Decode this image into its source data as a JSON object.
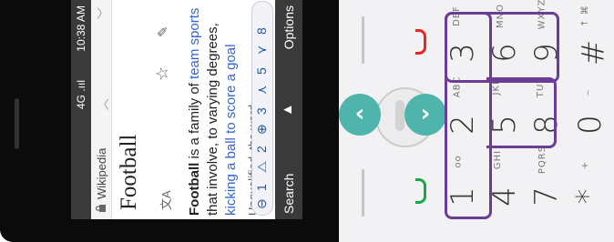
{
  "status": {
    "network": "4G .ııl",
    "battery_time": "10:38 AM"
  },
  "site": {
    "name": "Wikipedia"
  },
  "page": {
    "title": "Football"
  },
  "article": {
    "bold_word": "Football",
    "text1": " is a family of ",
    "link1": "team sports",
    "text2": " that involve, to varying degrees, ",
    "link2": "kicking a ball to score a goal",
    "tail": "Unqualified, the word"
  },
  "toolbar": {
    "items": [
      "⊖",
      "1",
      "⧍",
      "2",
      "⊕",
      "3",
      "⋏",
      "5",
      "⋎",
      "8"
    ]
  },
  "softkeys": {
    "left": "Search",
    "center": "▲",
    "right": "Options"
  },
  "keypad": {
    "keys": [
      {
        "digit": "1",
        "letters": "oo"
      },
      {
        "digit": "2",
        "letters": "ABC"
      },
      {
        "digit": "3",
        "letters": "DEF"
      },
      {
        "digit": "4",
        "letters": "GHI"
      },
      {
        "digit": "5",
        "letters": "JKL"
      },
      {
        "digit": "6",
        "letters": "MNO"
      },
      {
        "digit": "7",
        "letters": "PQRS"
      },
      {
        "digit": "8",
        "letters": "TUV"
      },
      {
        "digit": "9",
        "letters": "WXYZ"
      },
      {
        "digit": "*",
        "letters": "+"
      },
      {
        "digit": "0",
        "letters": "_"
      },
      {
        "digit": "#",
        "letters": "↑ ⌘"
      }
    ]
  },
  "colors": {
    "nav": "#4fb5ac",
    "highlight": "#6b3e93",
    "call_red": "#e8261f",
    "call_green": "#18a944",
    "link": "#3366cc"
  }
}
